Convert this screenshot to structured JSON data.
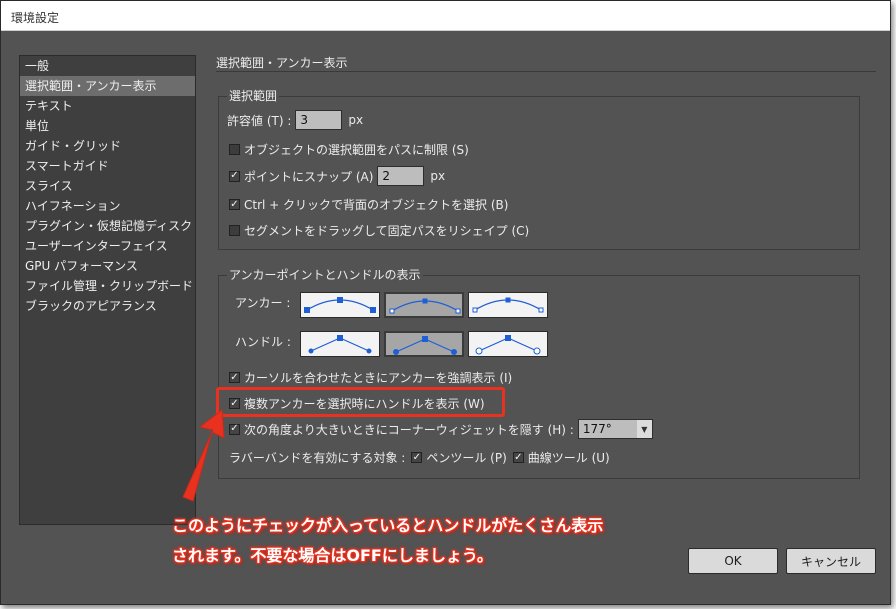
{
  "window": {
    "title": "環境設定"
  },
  "sidebar": {
    "items": [
      {
        "label": "一般",
        "selected": false
      },
      {
        "label": "選択範囲・アンカー表示",
        "selected": true
      },
      {
        "label": "テキスト",
        "selected": false
      },
      {
        "label": "単位",
        "selected": false
      },
      {
        "label": "ガイド・グリッド",
        "selected": false
      },
      {
        "label": "スマートガイド",
        "selected": false
      },
      {
        "label": "スライス",
        "selected": false
      },
      {
        "label": "ハイフネーション",
        "selected": false
      },
      {
        "label": "プラグイン・仮想記憶ディスク",
        "selected": false
      },
      {
        "label": "ユーザーインターフェイス",
        "selected": false
      },
      {
        "label": "GPU パフォーマンス",
        "selected": false
      },
      {
        "label": "ファイル管理・クリップボード",
        "selected": false
      },
      {
        "label": "ブラックのアピアランス",
        "selected": false
      }
    ]
  },
  "main": {
    "section_title": "選択範囲・アンカー表示",
    "selection": {
      "group_label": "選択範囲",
      "tolerance_label": "許容値 (T) :",
      "tolerance_value": "3",
      "tolerance_unit": "px",
      "object_selection_by_path": {
        "label": "オブジェクトの選択範囲をパスに制限 (S)",
        "checked": false
      },
      "snap_to_point": {
        "label": "ポイントにスナップ (A)",
        "checked": true,
        "value": "2",
        "unit": "px"
      },
      "ctrl_click": {
        "label": "Ctrl + クリックで背面のオブジェクトを選択 (B)",
        "checked": true
      },
      "segment_reshape": {
        "label": "セグメントをドラッグして固定パスをリシェイプ (C)",
        "checked": false
      }
    },
    "anchor_display": {
      "group_label": "アンカーポイントとハンドルの表示",
      "anchor_label": "アンカー :",
      "handle_label": "ハンドル :",
      "anchor_selected_index": 1,
      "handle_selected_index": 1,
      "highlight_on_cursor": {
        "label": "カーソルを合わせたときにアンカーを強調表示 (I)",
        "checked": true
      },
      "show_handles_multi": {
        "label": "複数アンカーを選択時にハンドルを表示 (W)",
        "checked": true
      },
      "hide_corner_widget": {
        "label": "次の角度より大きいときにコーナーウィジェットを隠す (H) :",
        "checked": true,
        "value": "177°"
      },
      "rubber_band_label": "ラバーバンドを有効にする対象 :",
      "pen_tool": {
        "label": "ペンツール (P)",
        "checked": true
      },
      "curvature_tool": {
        "label": "曲線ツール (U)",
        "checked": true
      }
    }
  },
  "annotation": {
    "line1": "このようにチェックが入っているとハンドルがたくさん表示",
    "line2": "されます。不要な場合はOFFにしましょう。",
    "color": "#e8321f"
  },
  "buttons": {
    "ok": "OK",
    "cancel": "キャンセル"
  },
  "icons": {
    "check": "✓",
    "dropdown_arrow": "▼"
  },
  "colors": {
    "panel": "#535353",
    "sidebar": "#3f3f3f",
    "selected": "#6d6d6d",
    "anchor_blue": "#1f5fd6"
  }
}
